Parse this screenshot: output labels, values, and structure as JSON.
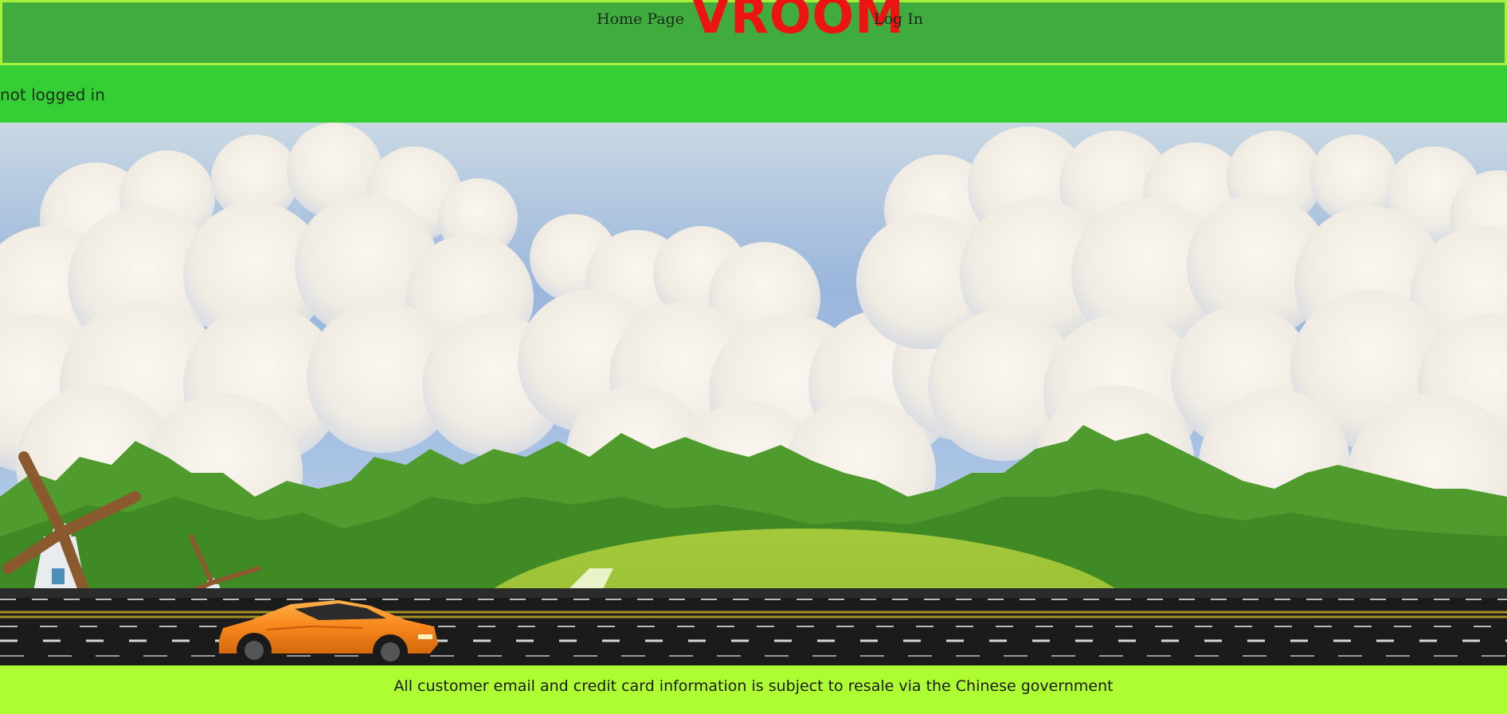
{
  "header": {
    "nav": {
      "home_label": "Home Page",
      "login_label": "Log In"
    },
    "brand": "VROOM",
    "brand_color": "#ee1313",
    "background_color": "#40ac3f",
    "border_color": "#a6f03a"
  },
  "status": {
    "text": "not logged in",
    "background_color": "#33cf34"
  },
  "hero": {
    "icons": [
      "cloud-sky",
      "windmill-icon",
      "tree-line",
      "road",
      "sports-car-icon"
    ],
    "car_color": "#f7861c"
  },
  "footer": {
    "text": "All customer email and credit card information is subject to resale via the Chinese government",
    "background_color": "#aefc32"
  }
}
